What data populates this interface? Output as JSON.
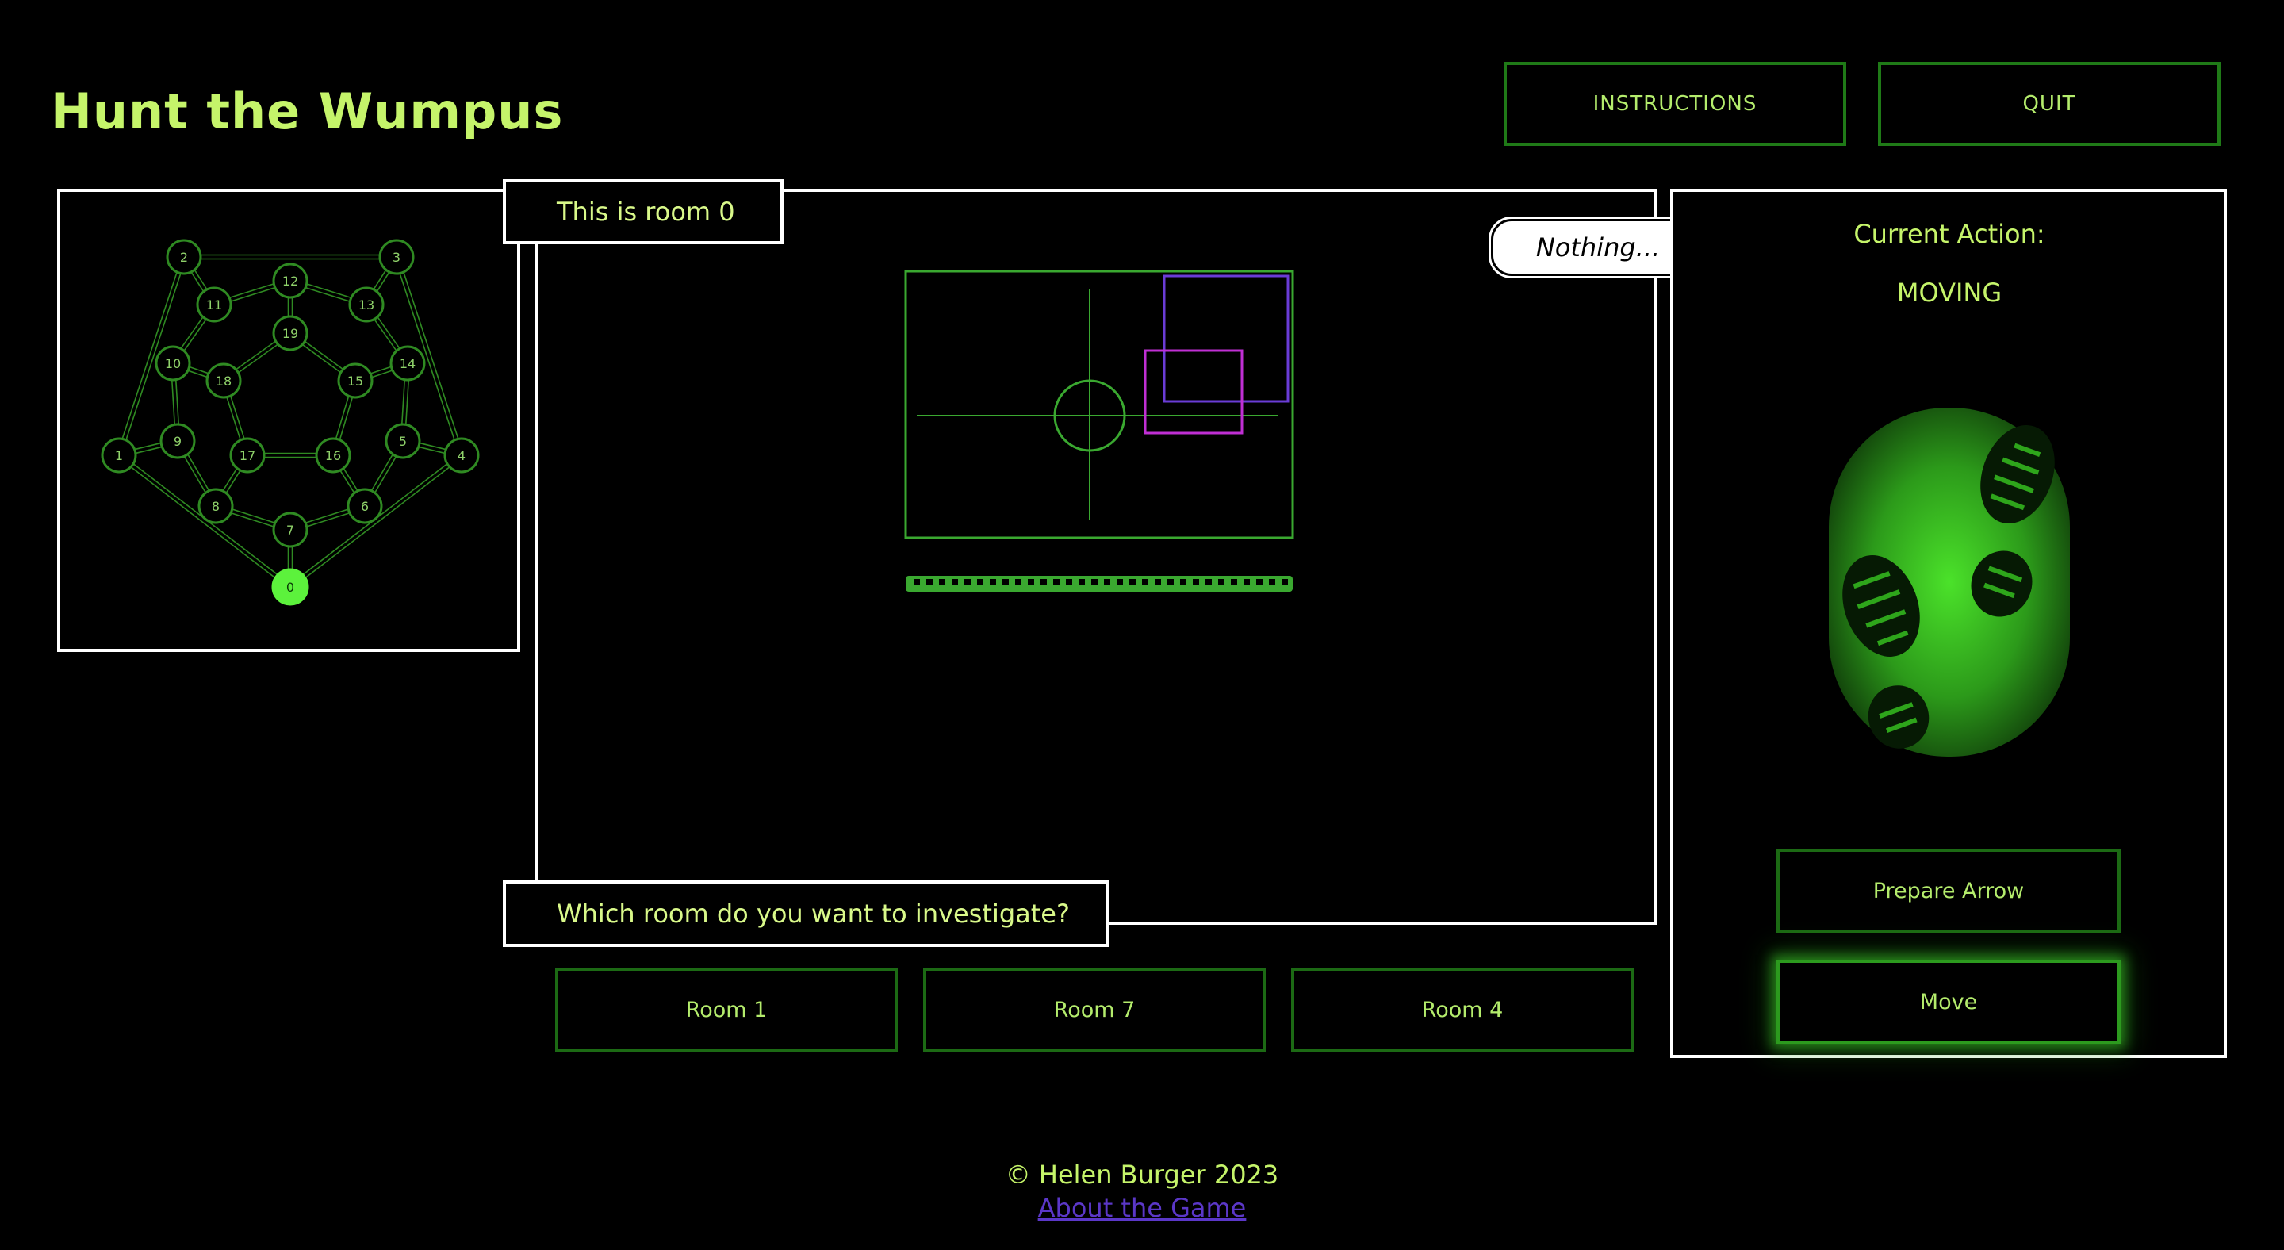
{
  "header": {
    "title": "Hunt the Wumpus",
    "instructions_label": "INSTRUCTIONS",
    "quit_label": "QUIT"
  },
  "map": {
    "current_room": "0",
    "nodes": [
      {
        "id": "0",
        "label": "0"
      },
      {
        "id": "1",
        "label": "1"
      },
      {
        "id": "2",
        "label": "2"
      },
      {
        "id": "3",
        "label": "3"
      },
      {
        "id": "4",
        "label": "4"
      },
      {
        "id": "5",
        "label": "5"
      },
      {
        "id": "6",
        "label": "6"
      },
      {
        "id": "7",
        "label": "7"
      },
      {
        "id": "8",
        "label": "8"
      },
      {
        "id": "9",
        "label": "9"
      },
      {
        "id": "10",
        "label": "10"
      },
      {
        "id": "11",
        "label": "11"
      },
      {
        "id": "12",
        "label": "12"
      },
      {
        "id": "13",
        "label": "13"
      },
      {
        "id": "14",
        "label": "14"
      },
      {
        "id": "15",
        "label": "15"
      },
      {
        "id": "16",
        "label": "16"
      },
      {
        "id": "17",
        "label": "17"
      },
      {
        "id": "18",
        "label": "18"
      },
      {
        "id": "19",
        "label": "19"
      }
    ],
    "edges": [
      [
        "0",
        "1"
      ],
      [
        "1",
        "2"
      ],
      [
        "2",
        "3"
      ],
      [
        "3",
        "4"
      ],
      [
        "4",
        "0"
      ],
      [
        "0",
        "7"
      ],
      [
        "1",
        "9"
      ],
      [
        "2",
        "11"
      ],
      [
        "3",
        "13"
      ],
      [
        "4",
        "5"
      ],
      [
        "7",
        "8"
      ],
      [
        "8",
        "9"
      ],
      [
        "9",
        "10"
      ],
      [
        "10",
        "11"
      ],
      [
        "11",
        "12"
      ],
      [
        "12",
        "13"
      ],
      [
        "13",
        "14"
      ],
      [
        "14",
        "5"
      ],
      [
        "5",
        "6"
      ],
      [
        "6",
        "7"
      ],
      [
        "8",
        "17"
      ],
      [
        "10",
        "18"
      ],
      [
        "12",
        "19"
      ],
      [
        "14",
        "15"
      ],
      [
        "6",
        "16"
      ],
      [
        "17",
        "18"
      ],
      [
        "18",
        "19"
      ],
      [
        "19",
        "15"
      ],
      [
        "15",
        "16"
      ],
      [
        "16",
        "17"
      ]
    ]
  },
  "room": {
    "title": "This is room 0",
    "status": "Nothing...",
    "question": "Which room do you want to investigate?"
  },
  "room_choices": [
    {
      "label": "Room 1"
    },
    {
      "label": "Room 7"
    },
    {
      "label": "Room 4"
    }
  ],
  "action": {
    "heading": "Current Action:",
    "value": "MOVING",
    "prepare_arrow_label": "Prepare Arrow",
    "move_label": "Move"
  },
  "colors": {
    "accent": "#c5f46a",
    "button_border": "#1c6a14",
    "current_room": "#5cf23c",
    "link": "#5b37c8"
  },
  "footer": {
    "copyright": "© Helen Burger 2023",
    "about_link": "About the Game"
  }
}
